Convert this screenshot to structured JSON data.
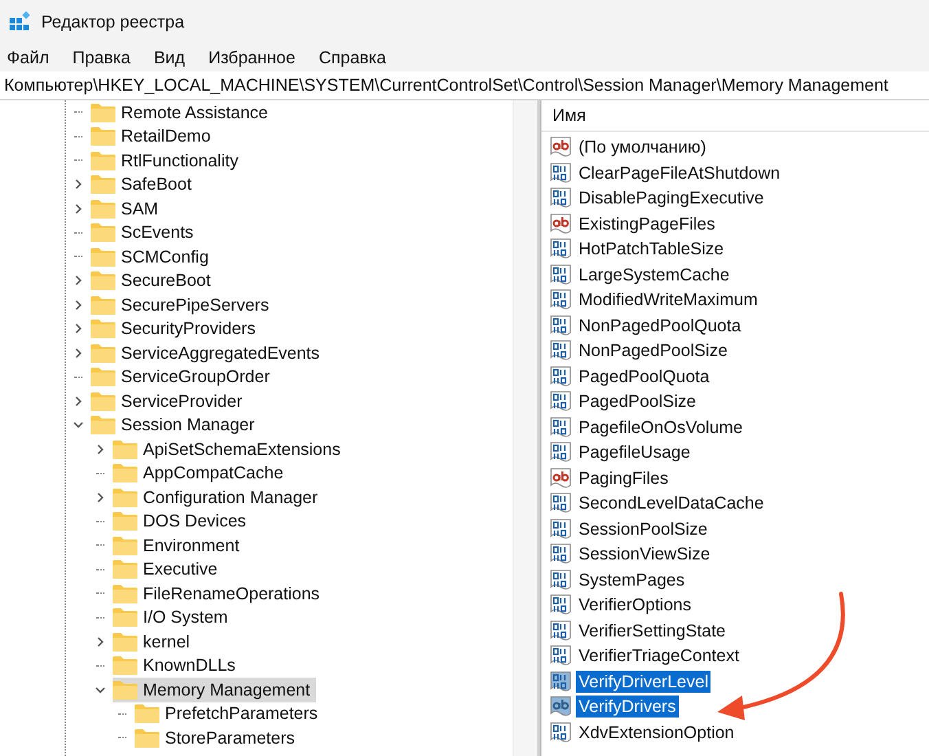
{
  "window": {
    "title": "Редактор реестра"
  },
  "menu": [
    "Файл",
    "Правка",
    "Вид",
    "Избранное",
    "Справка"
  ],
  "address": "Компьютер\\HKEY_LOCAL_MACHINE\\SYSTEM\\CurrentControlSet\\Control\\Session Manager\\Memory Management",
  "tree": [
    {
      "label": "Remote Assistance",
      "kind": "leaf",
      "selected": false
    },
    {
      "label": "RetailDemo",
      "kind": "leaf",
      "selected": false
    },
    {
      "label": "RtlFunctionality",
      "kind": "leaf",
      "selected": false
    },
    {
      "label": "SafeBoot",
      "kind": "branch",
      "expanded": false,
      "selected": false
    },
    {
      "label": "SAM",
      "kind": "branch",
      "expanded": false,
      "selected": false
    },
    {
      "label": "ScEvents",
      "kind": "leaf",
      "selected": false
    },
    {
      "label": "SCMConfig",
      "kind": "leaf",
      "selected": false
    },
    {
      "label": "SecureBoot",
      "kind": "branch",
      "expanded": false,
      "selected": false
    },
    {
      "label": "SecurePipeServers",
      "kind": "branch",
      "expanded": false,
      "selected": false
    },
    {
      "label": "SecurityProviders",
      "kind": "branch",
      "expanded": false,
      "selected": false
    },
    {
      "label": "ServiceAggregatedEvents",
      "kind": "branch",
      "expanded": false,
      "selected": false
    },
    {
      "label": "ServiceGroupOrder",
      "kind": "leaf",
      "selected": false
    },
    {
      "label": "ServiceProvider",
      "kind": "branch",
      "expanded": false,
      "selected": false
    },
    {
      "label": "Session Manager",
      "kind": "branch",
      "expanded": true,
      "selected": false,
      "children": [
        {
          "label": "ApiSetSchemaExtensions",
          "kind": "branch",
          "expanded": false,
          "selected": false
        },
        {
          "label": "AppCompatCache",
          "kind": "leaf",
          "selected": false
        },
        {
          "label": "Configuration Manager",
          "kind": "branch",
          "expanded": false,
          "selected": false
        },
        {
          "label": "DOS Devices",
          "kind": "leaf",
          "selected": false
        },
        {
          "label": "Environment",
          "kind": "leaf",
          "selected": false
        },
        {
          "label": "Executive",
          "kind": "leaf",
          "selected": false
        },
        {
          "label": "FileRenameOperations",
          "kind": "leaf",
          "selected": false
        },
        {
          "label": "I/O System",
          "kind": "leaf",
          "selected": false
        },
        {
          "label": "kernel",
          "kind": "branch",
          "expanded": false,
          "selected": false
        },
        {
          "label": "KnownDLLs",
          "kind": "leaf",
          "selected": false
        },
        {
          "label": "Memory Management",
          "kind": "branch",
          "expanded": true,
          "selected": true,
          "children": [
            {
              "label": "PrefetchParameters",
              "kind": "leaf",
              "selected": false
            },
            {
              "label": "StoreParameters",
              "kind": "leaf",
              "selected": false
            }
          ]
        }
      ]
    }
  ],
  "values_header": "Имя",
  "values": [
    {
      "name": "(По умолчанию)",
      "kind": "string",
      "selected": false
    },
    {
      "name": "ClearPageFileAtShutdown",
      "kind": "dword",
      "selected": false
    },
    {
      "name": "DisablePagingExecutive",
      "kind": "dword",
      "selected": false
    },
    {
      "name": "ExistingPageFiles",
      "kind": "string",
      "selected": false
    },
    {
      "name": "HotPatchTableSize",
      "kind": "dword",
      "selected": false
    },
    {
      "name": "LargeSystemCache",
      "kind": "dword",
      "selected": false
    },
    {
      "name": "ModifiedWriteMaximum",
      "kind": "dword",
      "selected": false
    },
    {
      "name": "NonPagedPoolQuota",
      "kind": "dword",
      "selected": false
    },
    {
      "name": "NonPagedPoolSize",
      "kind": "dword",
      "selected": false
    },
    {
      "name": "PagedPoolQuota",
      "kind": "dword",
      "selected": false
    },
    {
      "name": "PagedPoolSize",
      "kind": "dword",
      "selected": false
    },
    {
      "name": "PagefileOnOsVolume",
      "kind": "dword",
      "selected": false
    },
    {
      "name": "PagefileUsage",
      "kind": "dword",
      "selected": false
    },
    {
      "name": "PagingFiles",
      "kind": "string",
      "selected": false
    },
    {
      "name": "SecondLevelDataCache",
      "kind": "dword",
      "selected": false
    },
    {
      "name": "SessionPoolSize",
      "kind": "dword",
      "selected": false
    },
    {
      "name": "SessionViewSize",
      "kind": "dword",
      "selected": false
    },
    {
      "name": "SystemPages",
      "kind": "dword",
      "selected": false
    },
    {
      "name": "VerifierOptions",
      "kind": "dword",
      "selected": false
    },
    {
      "name": "VerifierSettingState",
      "kind": "dword",
      "selected": false
    },
    {
      "name": "VerifierTriageContext",
      "kind": "dword",
      "selected": false
    },
    {
      "name": "VerifyDriverLevel",
      "kind": "dword",
      "selected": true
    },
    {
      "name": "VerifyDrivers",
      "kind": "string",
      "selected": true
    },
    {
      "name": "XdvExtensionOption",
      "kind": "dword",
      "selected": false
    }
  ]
}
